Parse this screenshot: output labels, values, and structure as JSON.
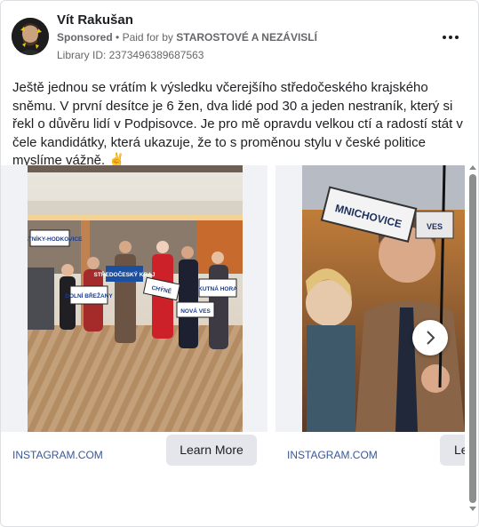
{
  "post": {
    "author": "Vít Rakušan",
    "sponsored_label": "Sponsored",
    "paid_for_prefix": "Paid for by",
    "payer": "STAROSTOVÉ A NEZÁVISLÍ",
    "library_id": "Library ID: 2373496389687563",
    "body": "Ještě jednou se vrátím k výsledku včerejšího středočeského krajského sněmu. V první desítce je 6 žen, dva lidé pod 30 a jeden nestraník, který si řekl o důvěru lidí v Podpisovce. Je pro mě opravdu velkou ctí a radostí stát v čele kandidátky, která ukazuje, že to s proměnou stylu v české politice myslíme vážně. ✌️"
  },
  "carousel": {
    "cards": [
      {
        "url": "INSTAGRAM.COM",
        "cta": "Learn More",
        "signs": [
          "ZLATNÍKY-HODKOVICE",
          "STŘEDOČESKÝ KRAJ",
          "DOLNÍ BŘEŽANY",
          "CHÝNĚ",
          "KUTNÁ HORA",
          "NOVÁ VES"
        ]
      },
      {
        "url": "INSTAGRAM.COM",
        "cta": "Le",
        "signs": [
          "MNICHOVICE",
          "VES"
        ]
      }
    ]
  }
}
